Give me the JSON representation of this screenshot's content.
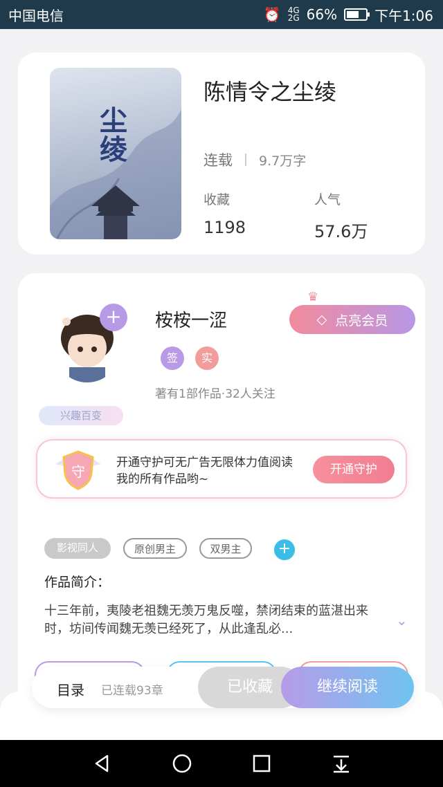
{
  "status": {
    "carrier": "中国电信",
    "battery_pct_text": "66%",
    "battery_level": 0.66,
    "time": "下午1:06"
  },
  "book": {
    "title": "陈情令之尘绫",
    "status": "连载",
    "word_count": "9.7万字",
    "collect_label": "收藏",
    "collect_count": "1198",
    "popularity_label": "人气",
    "popularity_value": "57.6万"
  },
  "author": {
    "name": "桉桉一涩",
    "interest_badge": "兴趣百变",
    "vip_label": "点亮会员",
    "sign_badge": "签",
    "real_badge": "实",
    "info": "著有1部作品·32人关注"
  },
  "guard": {
    "icon_text": "守",
    "text": "开通守护可无广告无限体力值阅读我的所有作品哟~",
    "button": "开通守护"
  },
  "tags": [
    "影视同人",
    "原创男主",
    "双男主"
  ],
  "intro": {
    "title": "作品简介：",
    "text": "十三年前，夷陵老祖魏无羡万鬼反噬，禁闭结束的蓝湛出来时，坊间传闻魏无羡已经死了，从此逢乱必..."
  },
  "actions": {
    "toc": "目录",
    "serialized": "已连载93章",
    "collected": "已收藏",
    "continue": "继续阅读"
  },
  "colors": {
    "accent_purple": "#b79ae6",
    "accent_blue": "#6fc4ef",
    "accent_pink": "#f28a9c"
  }
}
